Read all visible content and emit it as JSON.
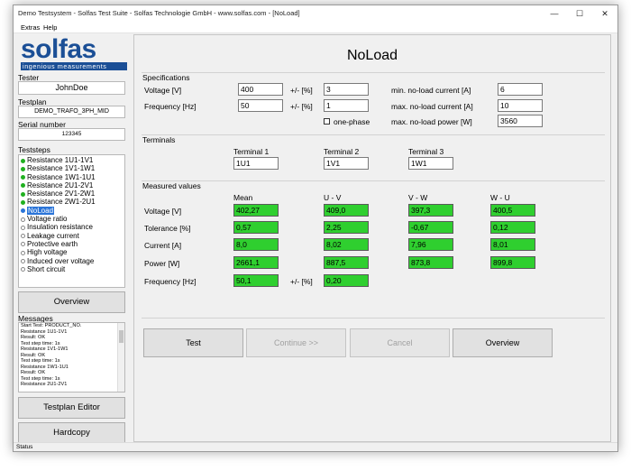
{
  "window": {
    "title": "Demo Testsystem - Solfas Test Suite - Solfas Technologie GmbH - www.solfas.com - [NoLoad]"
  },
  "menu": {
    "extras": "Extras",
    "help": "Help"
  },
  "logo": {
    "brand": "solfas",
    "tagline": "ingenious measurements"
  },
  "sidebar": {
    "tester_label": "Tester",
    "tester_value": "JohnDoe",
    "testplan_label": "Testplan",
    "testplan_value": "DEMO_TRAFO_3PH_MID",
    "serial_label": "Serial number",
    "serial_value": "123345",
    "teststeps_label": "Teststeps",
    "steps": [
      {
        "label": "Resistance 1U1-1V1",
        "state": "done"
      },
      {
        "label": "Resistance 1V1-1W1",
        "state": "done"
      },
      {
        "label": "Resistance 1W1-1U1",
        "state": "done"
      },
      {
        "label": "Resistance 2U1-2V1",
        "state": "done"
      },
      {
        "label": "Resistance 2V1-2W1",
        "state": "done"
      },
      {
        "label": "Resistance 2W1-2U1",
        "state": "done"
      },
      {
        "label": "NoLoad",
        "state": "active"
      },
      {
        "label": "Voltage ratio",
        "state": "pending"
      },
      {
        "label": "Insulation resistance",
        "state": "pending"
      },
      {
        "label": "Leakage current",
        "state": "pending"
      },
      {
        "label": "Protective earth",
        "state": "pending"
      },
      {
        "label": "High voltage",
        "state": "pending"
      },
      {
        "label": "Induced over voltage",
        "state": "pending"
      },
      {
        "label": "Short circuit",
        "state": "pending"
      }
    ],
    "overview_button": "Overview",
    "messages_label": "Messages",
    "messages": [
      "Start Test: PRODUCT_NO.",
      "Resistance 1U1-1V1",
      "Result: OK",
      "Test step time: 1s",
      "Resistance 1V1-1W1",
      "Result: OK",
      "Test step time: 1s",
      "Resistance 1W1-1U1",
      "Result: OK",
      "Test step time: 1s",
      "Resistance 2U1-2V1"
    ],
    "testplan_editor_button": "Testplan Editor",
    "hardcopy_button": "Hardcopy"
  },
  "main": {
    "title": "NoLoad",
    "specifications": {
      "title": "Specifications",
      "voltage_label": "Voltage [V]",
      "voltage_value": "400",
      "voltage_tol_label": "+/- [%]",
      "voltage_tol_value": "3",
      "frequency_label": "Frequency [Hz]",
      "frequency_value": "50",
      "frequency_tol_label": "+/- [%]",
      "frequency_tol_value": "1",
      "one_phase_label": "one-phase",
      "one_phase_checked": false,
      "min_current_label": "min. no-load current [A]",
      "min_current_value": "6",
      "max_current_label": "max. no-load current [A]",
      "max_current_value": "10",
      "max_power_label": "max. no-load power [W]",
      "max_power_value": "3560"
    },
    "terminals": {
      "title": "Terminals",
      "t1_label": "Terminal 1",
      "t1_value": "1U1",
      "t2_label": "Terminal 2",
      "t2_value": "1V1",
      "t3_label": "Terminal 3",
      "t3_value": "1W1"
    },
    "measured": {
      "title": "Measured values",
      "columns": [
        "Mean",
        "U - V",
        "V - W",
        "W - U"
      ],
      "voltage_label": "Voltage [V]",
      "voltage": [
        "402,27",
        "409,0",
        "397,3",
        "400,5"
      ],
      "tolerance_label": "Tolerance [%]",
      "tolerance": [
        "0,57",
        "2,25",
        "-0,67",
        "0,12"
      ],
      "current_label": "Current [A]",
      "current": [
        "8,0",
        "8,02",
        "7,96",
        "8,01"
      ],
      "power_label": "Power [W]",
      "power": [
        "2661,1",
        "887,5",
        "873,8",
        "899,8"
      ],
      "frequency_label": "Frequency [Hz]",
      "frequency_value": "50,1",
      "frequency_tol_label": "+/- [%]",
      "frequency_tol_value": "0,20"
    },
    "buttons": {
      "test": "Test",
      "continue": "Continue >>",
      "cancel": "Cancel",
      "overview": "Overview"
    },
    "measured_color": "#2fcf2f"
  },
  "status": {
    "text": "Status"
  }
}
